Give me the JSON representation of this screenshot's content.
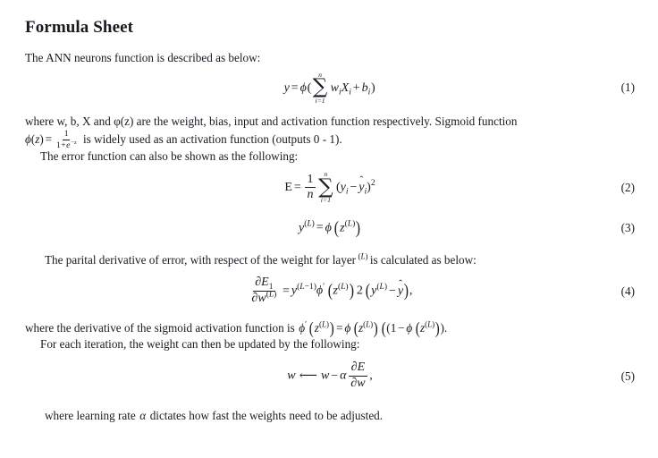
{
  "document": {
    "title": "Formula Sheet",
    "intro": "The ANN neurons function is described as below:",
    "paragraph_where_1_a": "where w, b, X and φ(z) are the weight, bias, input and activation function respectively. Sigmoid function",
    "paragraph_where_1_b_prefix": "φ(z) =",
    "paragraph_where_1_b_suffix": "is widely used as an activation function (outputs 0 - 1).",
    "paragraph_error_intro": "The error function can also be shown as the following:",
    "paragraph_partial_intro_a": "The parital derivative of error, with respect of the weight for layer",
    "paragraph_partial_intro_sup": "(L)",
    "paragraph_partial_intro_b": "is calculated as below:",
    "paragraph_sigmoid_deriv_prefix": "where the derivative of the sigmoid activation function is",
    "paragraph_iteration": "For each iteration, the weight can then be updated by the following:",
    "paragraph_learning_rate_a": "where learning rate",
    "paragraph_learning_rate_alpha": "α",
    "paragraph_learning_rate_b": "dictates how fast the weights need to be adjusted."
  },
  "equations": {
    "eq1": {
      "number": "(1)",
      "latex": "y = \\phi(\\sum_{i=1}^{n} w_i X_i + b_i)",
      "plain": "y = φ(∑ i=1 to n  w_i X_i + b_i)",
      "tokens": {
        "lhs": "y",
        "equals": "=",
        "phi": "φ",
        "open_paren": "(",
        "sigma": "∑",
        "sum_upper": "n",
        "sum_lower": "i=1",
        "w": "w",
        "w_sub": "i",
        "X": "X",
        "X_sub": "i",
        "plus": "+",
        "b": "b",
        "b_sub": "i",
        "close_paren": ")"
      }
    },
    "eq2": {
      "number": "(2)",
      "latex": "E = \\frac{1}{n}\\sum_{i=1}^{n}(y_i-\\hat{y}_i)^2",
      "plain": "E = (1/n) ∑ i=1 to n (y_i − ŷ_i)^2",
      "tokens": {
        "lhs": "E",
        "equals": "=",
        "frac_num": "1",
        "frac_den": "n",
        "sigma": "∑",
        "sum_upper": "n",
        "sum_lower": "i=1",
        "open_paren": "(",
        "y": "y",
        "y_sub": "i",
        "minus": "−",
        "yhat": "y",
        "hat": "̂",
        "yhat_sub": "i",
        "close_paren": ")",
        "power": "2"
      }
    },
    "eq3": {
      "number": "(3)",
      "latex": "y^{(L)} = \\phi\\left(z^{(L)}\\right)",
      "plain": "y^(L) = φ(z^(L))",
      "tokens": {
        "y": "y",
        "y_sup": "(L)",
        "equals": "=",
        "phi": "φ",
        "open_paren": "(",
        "z": "z",
        "z_sup": "(L)",
        "close_paren": ")"
      }
    },
    "eq4": {
      "number": "(4)",
      "latex": "\\frac{\\partial E_1}{\\partial w^{(L)}} = y^{(L-1)}\\phi'\\left(z^{(L)}\\right)2\\left(y^{(L)}-\\hat{y}\\right),",
      "plain": "∂E₁/∂w^(L) = y^(L−1) φ'(z^(L)) 2 (y^(L) − ŷ),",
      "tokens": {
        "partial": "∂",
        "E": "E",
        "E_sub": "1",
        "w": "w",
        "w_sup": "(L)",
        "equals": "=",
        "y": "y",
        "y_sup": "(L−1)",
        "phi_prime": "φ′",
        "z": "z",
        "z_sup": "(L)",
        "two": "2",
        "y2": "y",
        "y2_sup": "(L)",
        "minus": "−",
        "yhat": "y",
        "hat": "̂",
        "comma": ","
      }
    },
    "eq5": {
      "number": "(5)",
      "latex": "w \\longleftarrow w - \\alpha\\frac{\\partial E}{\\partial w},",
      "plain": "w ⟵ w − α ∂E/∂w,",
      "tokens": {
        "w": "w",
        "arrow": "⟵",
        "w2": "w",
        "minus": "−",
        "alpha": "α",
        "partial": "∂",
        "E": "E",
        "partial2": "∂",
        "w3": "w",
        "comma": ","
      }
    },
    "inline_sigmoid": {
      "plain": "φ(z) = 1/(1+e^−z)",
      "tokens": {
        "phi": "φ",
        "open": "(",
        "z": "z",
        "close": ")",
        "equals": "=",
        "num": "1",
        "den_one": "1",
        "den_plus": "+",
        "den_e": "e",
        "den_exp": "−z"
      }
    },
    "inline_sigmoid_derivative": {
      "plain": "φ′(z^(L)) = φ(z^(L))((1 − φ(z^(L))).",
      "tokens": {
        "phi_prime": "φ′",
        "z": "z",
        "z_sup": "(L)",
        "equals": "=",
        "phi": "φ",
        "one": "1",
        "minus": "−",
        "period": "."
      }
    }
  },
  "colors": {
    "page_background": "#ffffff",
    "text": "#1a1a22"
  }
}
